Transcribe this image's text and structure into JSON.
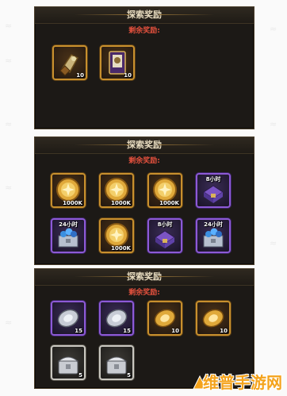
{
  "panels": [
    {
      "title": "探索奖励",
      "subtitle": "剩余奖励:",
      "items": [
        {
          "icon": "gauntlet-icon",
          "qty": "10",
          "frame": "gold"
        },
        {
          "icon": "card-icon",
          "qty": "10",
          "frame": "gold"
        }
      ]
    },
    {
      "title": "探索奖励",
      "subtitle": "剩余奖励:",
      "items": [
        {
          "icon": "gold-coin-icon",
          "qty": "1000K",
          "frame": "gold"
        },
        {
          "icon": "gold-coin-icon",
          "qty": "1000K",
          "frame": "gold"
        },
        {
          "icon": "gold-coin-icon",
          "qty": "1000K",
          "frame": "gold"
        },
        {
          "icon": "purple-chest-icon",
          "tag": "8小时",
          "frame": "purple"
        },
        {
          "icon": "gem-chest-icon",
          "tag": "24小时",
          "frame": "purple"
        },
        {
          "icon": "gold-coin-icon",
          "qty": "1000K",
          "frame": "gold"
        },
        {
          "icon": "purple-chest-icon",
          "tag": "8小时",
          "frame": "purple"
        },
        {
          "icon": "gem-chest-icon",
          "tag": "24小时",
          "frame": "purple"
        }
      ]
    },
    {
      "title": "探索奖励",
      "subtitle": "剩余奖励:",
      "items": [
        {
          "icon": "silver-seed-icon",
          "qty": "15",
          "frame": "purple"
        },
        {
          "icon": "silver-seed-icon",
          "qty": "15",
          "frame": "purple"
        },
        {
          "icon": "gold-seed-icon",
          "qty": "10",
          "frame": "gold"
        },
        {
          "icon": "gold-seed-icon",
          "qty": "10",
          "frame": "gold"
        },
        {
          "icon": "silver-chest-icon",
          "qty": "5",
          "frame": "white"
        },
        {
          "icon": "silver-chest-icon",
          "qty": "5",
          "frame": "white"
        }
      ]
    }
  ],
  "watermark": "维普手游网",
  "colors": {
    "gold": "#c8902e",
    "purple": "#8d5ad6",
    "subtitle": "#e1503d",
    "watermark": "#f4a31c"
  }
}
